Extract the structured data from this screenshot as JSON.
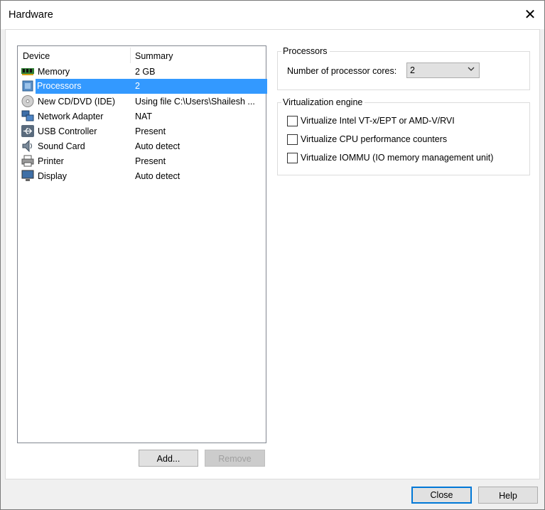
{
  "window": {
    "title": "Hardware"
  },
  "device_list": {
    "columns": [
      "Device",
      "Summary"
    ],
    "rows": [
      {
        "device": "Memory",
        "summary": "2 GB",
        "icon": "memory-icon"
      },
      {
        "device": "Processors",
        "summary": "2",
        "icon": "processor-icon",
        "selected": true
      },
      {
        "device": "New CD/DVD (IDE)",
        "summary": "Using file C:\\Users\\Shailesh ...",
        "icon": "cd-dvd-icon"
      },
      {
        "device": "Network Adapter",
        "summary": "NAT",
        "icon": "network-adapter-icon"
      },
      {
        "device": "USB Controller",
        "summary": "Present",
        "icon": "usb-controller-icon"
      },
      {
        "device": "Sound Card",
        "summary": "Auto detect",
        "icon": "sound-card-icon"
      },
      {
        "device": "Printer",
        "summary": "Present",
        "icon": "printer-icon"
      },
      {
        "device": "Display",
        "summary": "Auto detect",
        "icon": "display-icon"
      }
    ]
  },
  "buttons": {
    "add": "Add...",
    "remove": "Remove",
    "close": "Close",
    "help": "Help"
  },
  "processors": {
    "group_label": "Processors",
    "cores_label": "Number of processor cores:",
    "cores_value": "2"
  },
  "virtualization": {
    "group_label": "Virtualization engine",
    "options": [
      {
        "label": "Virtualize Intel VT-x/EPT or AMD-V/RVI",
        "checked": false
      },
      {
        "label": "Virtualize CPU performance counters",
        "checked": false
      },
      {
        "label": "Virtualize IOMMU (IO memory management unit)",
        "checked": false
      }
    ]
  },
  "colors": {
    "selection": "#3399ff",
    "default_button_border": "#0078d7"
  }
}
